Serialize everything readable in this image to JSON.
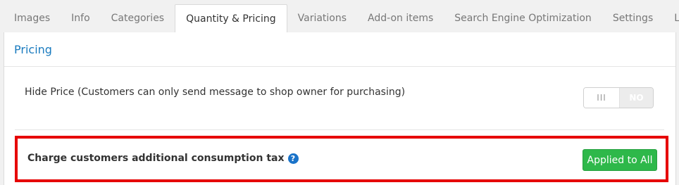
{
  "tabs": [
    {
      "label": "Images",
      "active": false
    },
    {
      "label": "Info",
      "active": false
    },
    {
      "label": "Categories",
      "active": false
    },
    {
      "label": "Quantity & Pricing",
      "active": true
    },
    {
      "label": "Variations",
      "active": false
    },
    {
      "label": "Add-on items",
      "active": false
    },
    {
      "label": "Search Engine Optimization",
      "active": false
    },
    {
      "label": "Settings",
      "active": false
    },
    {
      "label": "Logs",
      "active": false
    }
  ],
  "panel": {
    "title": "Pricing"
  },
  "hide_price": {
    "label": "Hide Price (Customers can only send message to shop owner for purchasing)",
    "toggle_handle": "III",
    "toggle_state": "NO"
  },
  "consumption_tax": {
    "label": "Charge customers additional consumption tax",
    "help_icon": "question-circle",
    "help_glyph": "?",
    "button_label": "Applied to All"
  },
  "colors": {
    "accent_blue": "#1a7bbf",
    "success_green": "#2eb84a",
    "highlight_red": "#e60000"
  }
}
